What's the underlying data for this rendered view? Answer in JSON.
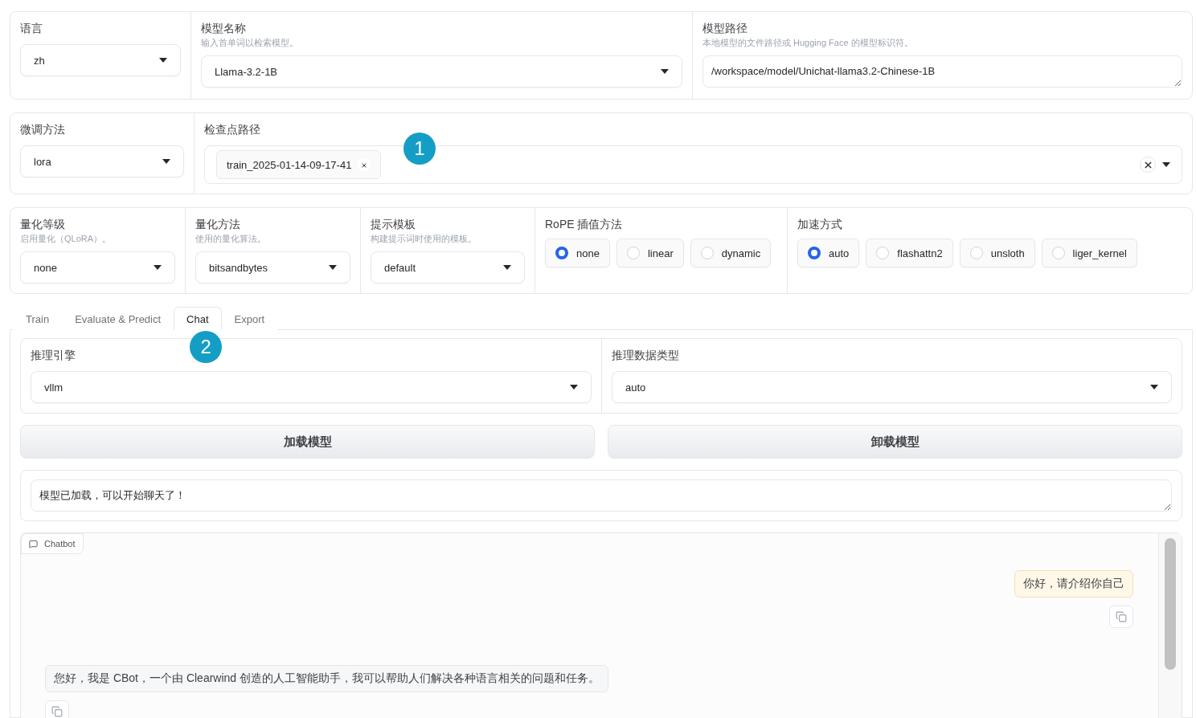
{
  "rows": [
    {
      "fields": [
        {
          "kind": "dropdown",
          "label": "语言",
          "value": "zh"
        },
        {
          "kind": "dropdown",
          "label": "模型名称",
          "hint": "输入首单词以检索模型。",
          "value": "Llama-3.2-1B"
        },
        {
          "kind": "textarea",
          "label": "模型路径",
          "hint": "本地模型的文件路径或 Hugging Face 的模型标识符。",
          "value": "/workspace/model/Unichat-llama3.2-Chinese-1B"
        }
      ]
    },
    {
      "fields": [
        {
          "kind": "dropdown",
          "label": "微调方法",
          "value": "lora"
        },
        {
          "kind": "tags",
          "label": "检查点路径",
          "tags": [
            "train_2025-01-14-09-17-41"
          ],
          "marker": "1"
        }
      ]
    },
    {
      "fields": [
        {
          "kind": "dropdown",
          "label": "量化等级",
          "hint": "启用量化（QLoRA）。",
          "value": "none"
        },
        {
          "kind": "dropdown",
          "label": "量化方法",
          "hint": "使用的量化算法。",
          "value": "bitsandbytes"
        },
        {
          "kind": "dropdown",
          "label": "提示模板",
          "hint": "构建提示词时使用的模板。",
          "value": "default"
        },
        {
          "kind": "radio",
          "label": "RoPE 插值方法",
          "options": [
            {
              "label": "none",
              "selected": true
            },
            {
              "label": "linear",
              "selected": false
            },
            {
              "label": "dynamic",
              "selected": false
            }
          ]
        },
        {
          "kind": "radio",
          "label": "加速方式",
          "options": [
            {
              "label": "auto",
              "selected": true
            },
            {
              "label": "flashattn2",
              "selected": false
            },
            {
              "label": "unsloth",
              "selected": false
            },
            {
              "label": "liger_kernel",
              "selected": false
            }
          ]
        }
      ]
    }
  ],
  "tabs": [
    {
      "label": "Train",
      "selected": false
    },
    {
      "label": "Evaluate & Predict",
      "selected": false
    },
    {
      "label": "Chat",
      "selected": true,
      "marker": "2"
    },
    {
      "label": "Export",
      "selected": false
    }
  ],
  "chat_panel": {
    "fields": [
      {
        "kind": "dropdown",
        "label": "推理引擎",
        "value": "vllm"
      },
      {
        "kind": "dropdown",
        "label": "推理数据类型",
        "value": "auto"
      }
    ],
    "buttons": [
      "加载模型",
      "卸载模型"
    ],
    "status": "模型已加载，可以开始聊天了！",
    "chatbot": {
      "label": "Chatbot",
      "messages": [
        {
          "kind": "user",
          "text": "你好，请介绍你自己"
        },
        {
          "kind": "bot",
          "text": "您好，我是 CBot，一个由 Clearwind 创造的人工智能助手，我可以帮助人们解决各种语言相关的问题和任务。"
        }
      ]
    }
  }
}
